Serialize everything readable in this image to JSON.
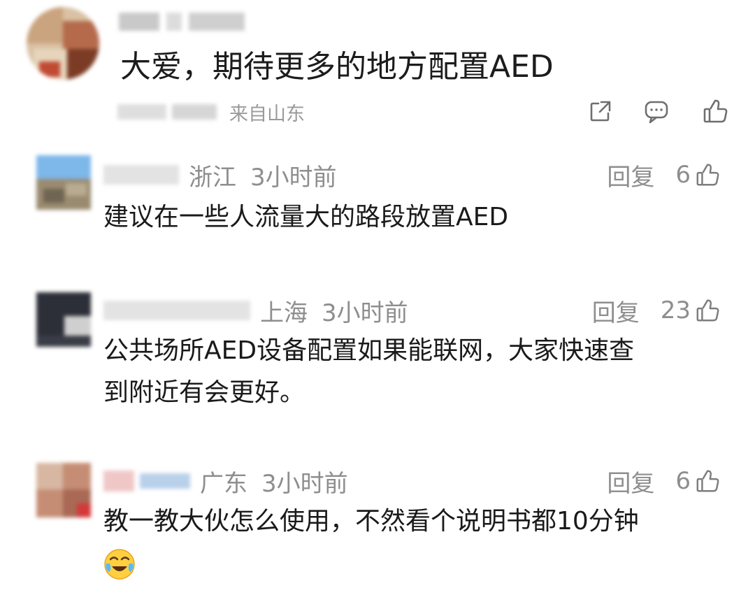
{
  "main_comment": {
    "text": "大爱，期待更多的地方配置AED",
    "location": "来自山东",
    "icons": [
      "share-icon",
      "comment-icon",
      "like-icon"
    ]
  },
  "replies": [
    {
      "location": "浙江",
      "time": "3小时前",
      "reply_label": "回复",
      "likes": "6",
      "text": "建议在一些人流量大的路段放置AED"
    },
    {
      "location": "上海",
      "time": "3小时前",
      "reply_label": "回复",
      "likes": "23",
      "text_lines": [
        "公共场所AED设备配置如果能联网，大家快速查",
        "到附近有会更好。"
      ]
    },
    {
      "location": "广东",
      "time": "3小时前",
      "reply_label": "回复",
      "likes": "6",
      "text": "教一教大伙怎么使用，不然看个说明书都10分钟",
      "emoji": "crying-laughing-emoji"
    }
  ],
  "colors": {
    "text": "#1a1a1a",
    "meta": "#8e8e8e",
    "icon": "#6f6f6f",
    "background": "#ffffff"
  }
}
